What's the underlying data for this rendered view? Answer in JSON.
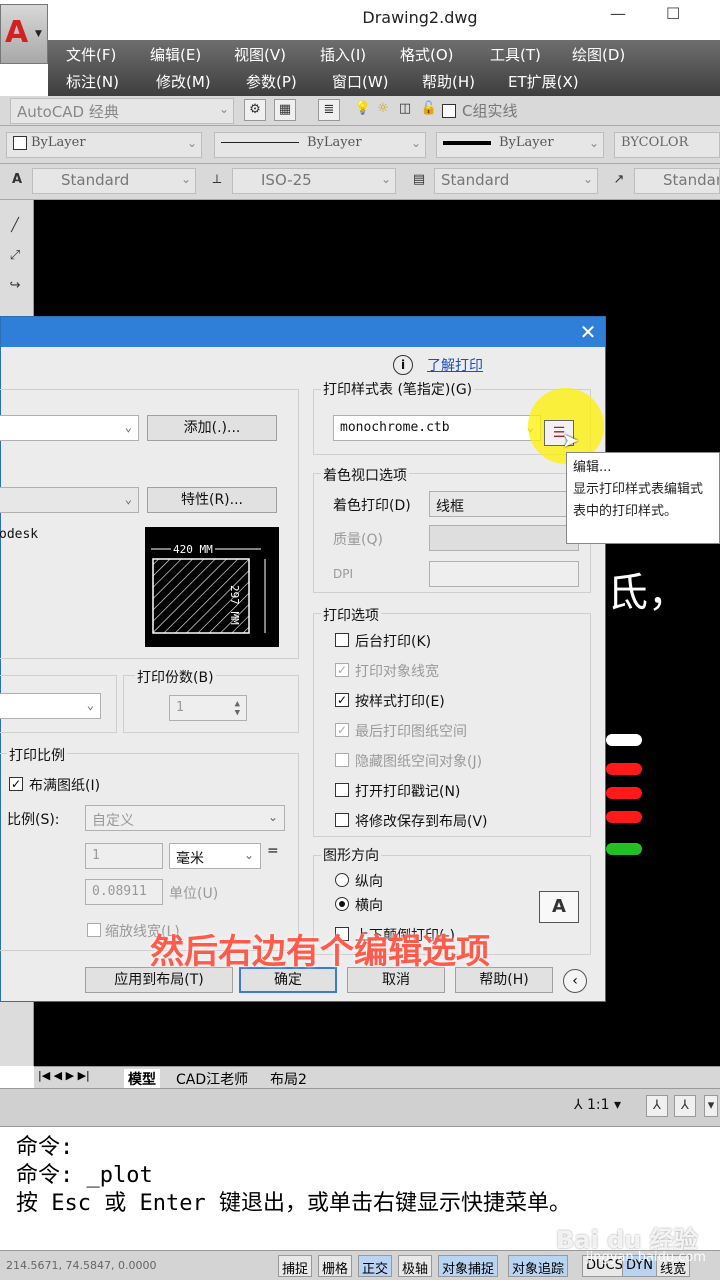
{
  "window": {
    "title": "Drawing2.dwg",
    "minimize": "—",
    "maximize": "☐"
  },
  "menubar": {
    "row1": [
      "文件(F)",
      "编辑(E)",
      "视图(V)",
      "插入(I)",
      "格式(O)",
      "工具(T)",
      "绘图(D)"
    ],
    "row2": [
      "标注(N)",
      "修改(M)",
      "参数(P)",
      "窗口(W)",
      "帮助(H)",
      "ET扩展(X)"
    ]
  },
  "toolbar": {
    "workspace": "AutoCAD 经典",
    "layer": "C组实线",
    "color": "ByLayer",
    "linetype": "ByLayer",
    "lineweight": "ByLayer",
    "plotstyle": "BYCOLOR",
    "text_style": "Standard",
    "dim_style": "ISO-25",
    "table_style": "Standard",
    "multileader_style": "Standar"
  },
  "dialog": {
    "help_link": "了解打印",
    "add_button": "添加(.)...",
    "properties_button": "特性(R)...",
    "plotter_fragment": "odesk",
    "paper_width": "420 MM",
    "paper_height": "297 MM",
    "copies_label": "打印份数(B)",
    "copies_value": "1",
    "scale_group": "打印比例",
    "fit_paper": "布满图纸(I)",
    "scale_label": "比例(S):",
    "scale_value": "自定义",
    "scale_num": "1",
    "scale_unit": "毫米",
    "scale_den": "0.08911",
    "unit_label": "单位(U)",
    "scale_lineweights": "缩放线宽(L)",
    "plot_style_group": "打印样式表 (笔指定)(G)",
    "plot_style_value": "monochrome.ctb",
    "shaded_group": "着色视口选项",
    "shade_plot_label": "着色打印(D)",
    "shade_plot_value": "线框",
    "quality_label": "质量(Q)",
    "dpi_label": "DPI",
    "options_group": "打印选项",
    "options": [
      {
        "label": "后台打印(K)",
        "checked": false,
        "disabled": false
      },
      {
        "label": "打印对象线宽",
        "checked": true,
        "disabled": true
      },
      {
        "label": "按样式打印(E)",
        "checked": true,
        "disabled": false
      },
      {
        "label": "最后打印图纸空间",
        "checked": true,
        "disabled": true
      },
      {
        "label": "隐藏图纸空间对象(J)",
        "checked": false,
        "disabled": true
      },
      {
        "label": "打开打印戳记(N)",
        "checked": false,
        "disabled": false
      },
      {
        "label": "将修改保存到布局(V)",
        "checked": false,
        "disabled": false
      }
    ],
    "orientation_group": "图形方向",
    "portrait": "纵向",
    "landscape": "横向",
    "upside_down": "上下颠倒打印(-)",
    "apply_button": "应用到布局(T)",
    "ok_button": "确定",
    "cancel_button": "取消",
    "help_button": "帮助(H)"
  },
  "tooltip": {
    "title": "编辑...",
    "desc": "显示打印样式表编辑式表中的打印样式。"
  },
  "caption": "然后右边有个编辑选项",
  "canvas_glyph": "氐，",
  "tabs": [
    "模型",
    "CAD江老师",
    "布局2"
  ],
  "annotation_scale": "1:1",
  "command_lines": [
    "命令:",
    "命令: _plot",
    "按 Esc 或 Enter 键退出，或单击右键显示快捷菜单。"
  ],
  "coords": "214.5671, 74.5847, 0.0000",
  "status_buttons": [
    "捕捉",
    "栅格",
    "正交",
    "极轴",
    "对象捕捉",
    "对象追踪",
    "DUCS",
    "DYN",
    "线宽"
  ],
  "watermark": "Bai du 经验",
  "watermark_url": "jingyan.baidu.com",
  "colors": {
    "dialog_title": "#2f7ed8",
    "canvas": "#000000",
    "caption": "#ff5a4a",
    "highlight": "#fff000"
  }
}
